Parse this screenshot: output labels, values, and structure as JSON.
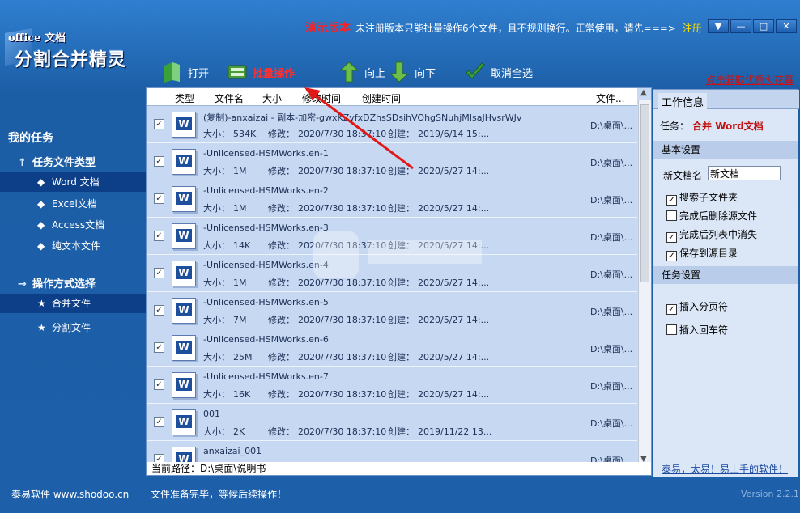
{
  "title_bar": {
    "logo_line1": "office 文档",
    "logo_line2": "分割合并精灵",
    "demo_label": "演示版本",
    "notice": "未注册版本只能批量操作6个文件，且不规则换行。正常使用，请先===>",
    "register_link": "注册",
    "window_buttons": [
      "▼",
      "—",
      "□",
      "✕"
    ]
  },
  "toolbar": {
    "open_label": "打开",
    "batch_label": "批量操作",
    "up_label": "向上",
    "down_label": "向下",
    "deselect_label": "取消全选",
    "promo_link": "点击获取优质火花幕"
  },
  "left_panel": {
    "my_tasks": "我的任务",
    "file_type_group": "任务文件类型",
    "file_types": [
      "Word 文档",
      "Excel文档",
      "Access文档",
      "纯文本文件"
    ],
    "selected_file_type": 0,
    "op_group": "操作方式选择",
    "ops": [
      "合并文件",
      "分割文件"
    ],
    "selected_op": 0,
    "brand": "泰易软件 www.shodoo.cn"
  },
  "list": {
    "columns": [
      "类型",
      "文件名",
      "大小",
      "修改时间",
      "创建时间",
      "文件..."
    ],
    "size_key": "大小：",
    "mod_key": "修改：",
    "create_key": "创建：",
    "rows": [
      {
        "name": "(复制)-anxaizai - 副本-加密-gwxKZvfxDZhsSDsihVOhgSNuhjMIsaJHvsrWJv",
        "size": "534K",
        "modified": "2020/7/30 18:37:10",
        "created": "2019/6/14 15:...",
        "path": "D:\\桌面\\...",
        "checked": true
      },
      {
        "name": "-Unlicensed-HSMWorks.en-1",
        "size": "1M",
        "modified": "2020/7/30 18:37:10",
        "created": "2020/5/27 14:...",
        "path": "D:\\桌面\\...",
        "checked": true
      },
      {
        "name": "-Unlicensed-HSMWorks.en-2",
        "size": "1M",
        "modified": "2020/7/30 18:37:10",
        "created": "2020/5/27 14:...",
        "path": "D:\\桌面\\...",
        "checked": true
      },
      {
        "name": "-Unlicensed-HSMWorks.en-3",
        "size": "14K",
        "modified": "2020/7/30 18:37:10",
        "created": "2020/5/27 14:...",
        "path": "D:\\桌面\\...",
        "checked": true
      },
      {
        "name": "-Unlicensed-HSMWorks.en-4",
        "size": "1M",
        "modified": "2020/7/30 18:37:10",
        "created": "2020/5/27 14:...",
        "path": "D:\\桌面\\...",
        "checked": true
      },
      {
        "name": "-Unlicensed-HSMWorks.en-5",
        "size": "7M",
        "modified": "2020/7/30 18:37:10",
        "created": "2020/5/27 14:...",
        "path": "D:\\桌面\\...",
        "checked": true
      },
      {
        "name": "-Unlicensed-HSMWorks.en-6",
        "size": "25M",
        "modified": "2020/7/30 18:37:10",
        "created": "2020/5/27 14:...",
        "path": "D:\\桌面\\...",
        "checked": true
      },
      {
        "name": "-Unlicensed-HSMWorks.en-7",
        "size": "16K",
        "modified": "2020/7/30 18:37:10",
        "created": "2020/5/27 14:...",
        "path": "D:\\桌面\\...",
        "checked": true
      },
      {
        "name": "001",
        "size": "2K",
        "modified": "2020/7/30 18:37:10",
        "created": "2019/11/22 13...",
        "path": "D:\\桌面\\...",
        "checked": true
      },
      {
        "name": "anxaizai_001",
        "size": "",
        "modified": "",
        "created": "",
        "path": "D:\\桌面\\...",
        "checked": true
      }
    ],
    "current_path_label": "当前路径：",
    "current_path": "D:\\桌面\\说明书"
  },
  "status": "文件准备完毕，等候后续操作！",
  "right_panel": {
    "tab": "工作信息",
    "task_label": "任务：",
    "task_value": "合并 Word文档",
    "basic_settings": "基本设置",
    "new_doc_label": "新文档名",
    "new_doc_value": "新文档",
    "options": [
      {
        "label": "搜索子文件夹",
        "checked": true
      },
      {
        "label": "完成后删除源文件",
        "checked": false
      },
      {
        "label": "完成后列表中消失",
        "checked": true
      },
      {
        "label": "保存到源目录",
        "checked": true
      }
    ],
    "task_settings": "任务设置",
    "task_options": [
      {
        "label": "插入分页符",
        "checked": true
      },
      {
        "label": "插入回车符",
        "checked": false
      }
    ],
    "slogan": "泰易，太易！易上手的软件！"
  },
  "version": "Version 2.2.1",
  "colors": {
    "accent_red": "#ff3030",
    "register_yellow": "#ffe000",
    "background": "#1d5fa8",
    "list_bg": "#c6d8f2"
  }
}
